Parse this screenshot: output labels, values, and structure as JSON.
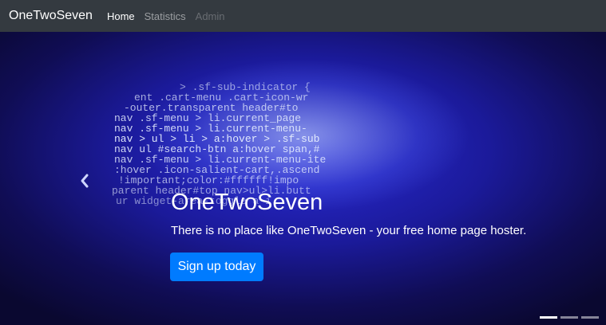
{
  "navbar": {
    "brand": "OneTwoSeven",
    "links": [
      {
        "label": "Home",
        "state": "active"
      },
      {
        "label": "Statistics",
        "state": "normal"
      },
      {
        "label": "Admin",
        "state": "disabled"
      }
    ]
  },
  "hero": {
    "title": "OneTwoSeven",
    "text": "There is no place like OneTwoSeven - your free home page hoster.",
    "cta_label": "Sign up today",
    "code_lines": [
      "> .sf-sub-indicator {",
      "ent .cart-menu .cart-icon-wr",
      "-outer.transparent header#to",
      "nav .sf-menu > li.current_page",
      "nav .sf-menu > li.current-menu-",
      "nav > ul > li > a:hover > .sf-sub",
      "nav ul #search-btn a:hover span,#",
      "nav .sf-menu > li.current-menu-ite",
      ":hover .icon-salient-cart,.ascend",
      "!important;color:#ffffff!impo",
      "parent header#top nav>ul>li.butt",
      "ur widget-area-toggle a i"
    ],
    "slide_count": 3,
    "active_slide": 1
  },
  "colors": {
    "navbar_bg": "#343a40",
    "primary": "#007bff"
  },
  "icons": {
    "prev": "chevron-left-icon"
  }
}
